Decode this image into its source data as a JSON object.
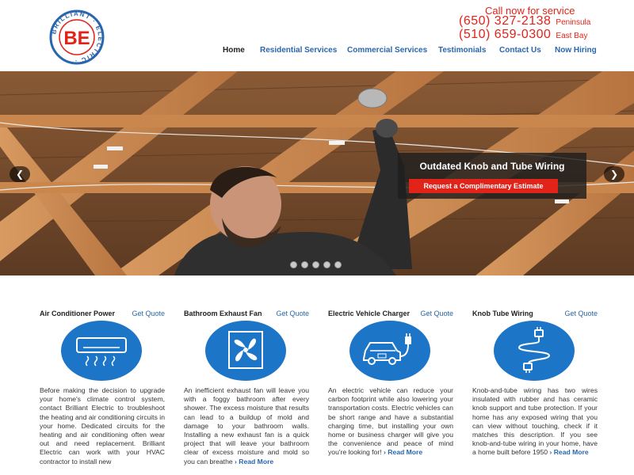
{
  "logo": {
    "monogram": "BE",
    "ring_text": "BRILLIANT · ELECTRIC ·"
  },
  "contact": {
    "call_label": "Call now for service",
    "phones": [
      {
        "number": "(650) 327-2138",
        "region": "Peninsula"
      },
      {
        "number": "(510) 659-0300",
        "region": "East Bay"
      }
    ]
  },
  "nav": {
    "items": [
      {
        "label": "Home",
        "active": true
      },
      {
        "label": "Residential Services"
      },
      {
        "label": "Commercial Services"
      },
      {
        "label": "Testimonials"
      },
      {
        "label": "Contact Us"
      },
      {
        "label": "Now Hiring"
      }
    ]
  },
  "hero": {
    "caption_title": "Outdated Knob and Tube Wiring",
    "cta_label": "Request a Complimentary Estimate",
    "prev_glyph": "❮",
    "next_glyph": "❯",
    "slide_count": 5,
    "active_slide": 0
  },
  "services": [
    {
      "title": "Air Conditioner Power",
      "quote_label": "Get Quote",
      "icon": "air-conditioner-icon",
      "text": "Before making the decision to upgrade your home's climate control system, contact Brilliant Electric to troubleshoot the heating and air conditioning circuits in your home. Dedicated circuits for the heating and air conditioning often wear out and need replacement. Brilliant Electric can work with your HVAC contractor to install new",
      "read_more": ""
    },
    {
      "title": "Bathroom Exhaust Fan",
      "quote_label": "Get Quote",
      "icon": "exhaust-fan-icon",
      "text": "An inefficient exhaust fan will leave you with a foggy bathroom after every shower. The excess moisture that results can lead to a buildup of mold and damage to your bathroom walls. Installing a new exhaust fan is a quick project that will leave your bathroom clear of excess moisture and mold so you can breathe",
      "read_more": "Read More"
    },
    {
      "title": "Electric Vehicle Charger",
      "quote_label": "Get Quote",
      "icon": "ev-charger-icon",
      "text": "An electric vehicle can reduce your carbon footprint while also lowering your transportation costs. Electric vehicles can be short range and have a substantial charging time, but installing your own home or business charger will give you the convenience and peace of mind you're looking for!",
      "read_more": "Read More"
    },
    {
      "title": "Knob Tube Wiring",
      "quote_label": "Get Quote",
      "icon": "knob-tube-wiring-icon",
      "text": "Knob-and-tube wiring has two wires insulated with rubber and has ceramic knob support and tube protection. If your home has any exposed wiring that you can view without touching, check if it matches this description. If you see knob-and-tube wiring in your home, have a home built before 1950",
      "read_more": "Read More"
    }
  ],
  "colors": {
    "brand_red": "#e2231a",
    "brand_blue": "#2a66ad",
    "icon_blue": "#1d75c7"
  }
}
